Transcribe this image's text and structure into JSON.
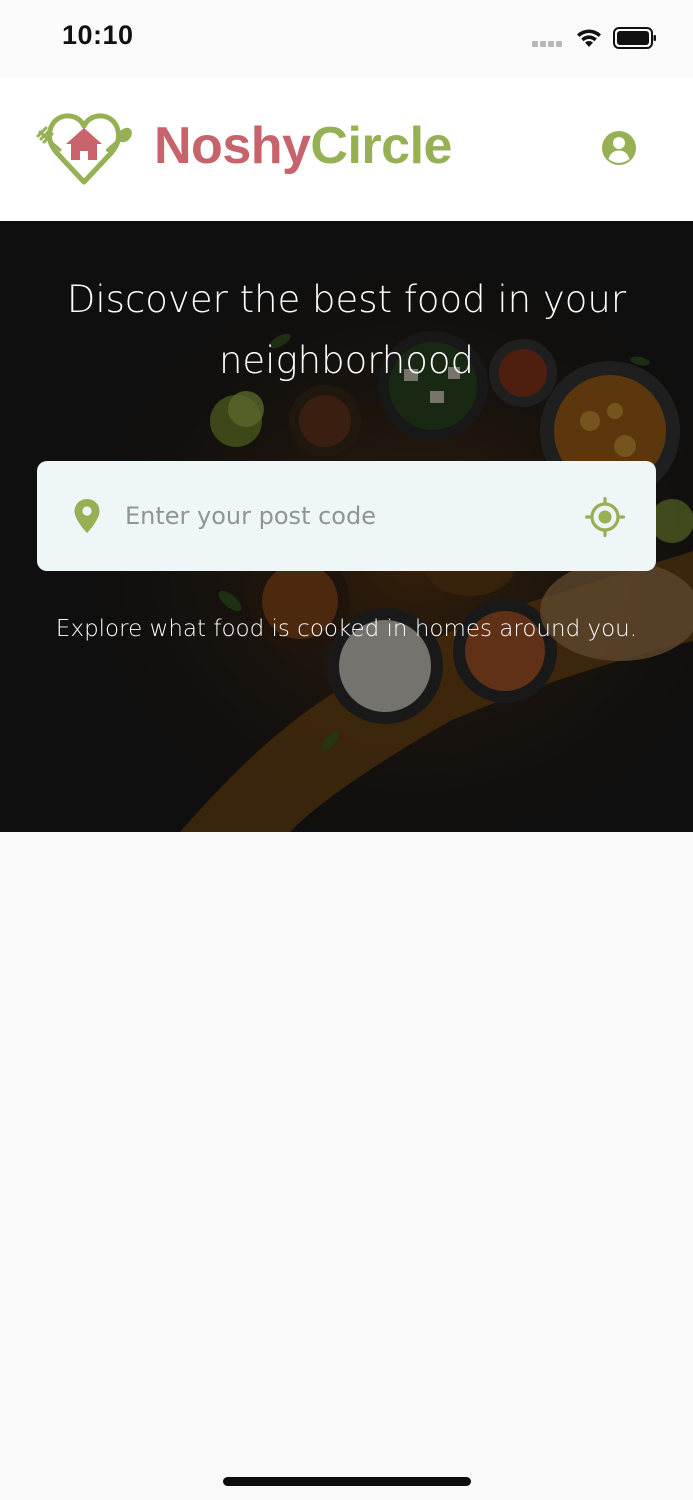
{
  "status_bar": {
    "time": "10:10",
    "icons": [
      "cellular-signal-icon",
      "wifi-icon",
      "battery-icon"
    ]
  },
  "header": {
    "logo_part1": "Noshy",
    "logo_part2": "Circle",
    "logo_icon": "heart-house-fork-spoon-icon",
    "profile_icon": "user-circle-icon"
  },
  "hero": {
    "title_line1": "Discover the best food in your",
    "title_line2": "neighborhood",
    "search": {
      "placeholder": "Enter your post code",
      "value": "",
      "left_icon": "map-pin-icon",
      "right_icon": "crosshair-locate-icon"
    },
    "subtitle": "Explore what food is cooked in homes around you."
  },
  "colors": {
    "brand_red": "#c8636b",
    "brand_green": "#96b054",
    "search_bg": "#eff6f7",
    "page_bg": "#f9f9f9"
  }
}
